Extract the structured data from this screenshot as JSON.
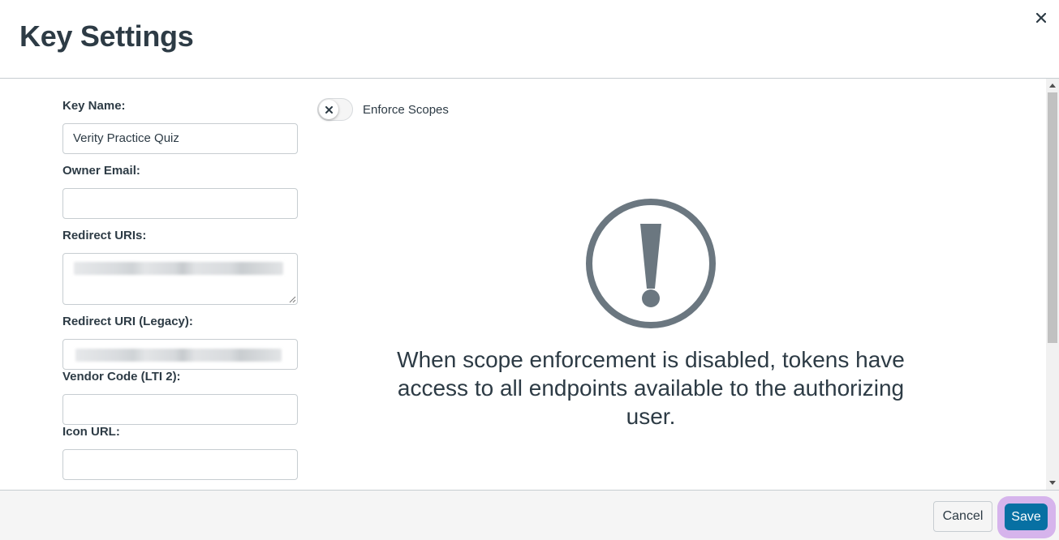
{
  "dialog": {
    "title": "Key Settings",
    "close_icon": "close-icon"
  },
  "form": {
    "key_name": {
      "label": "Key Name:",
      "value": "Verity Practice Quiz"
    },
    "owner_email": {
      "label": "Owner Email:",
      "value": ""
    },
    "redirect_uris": {
      "label": "Redirect URIs:",
      "value_redacted": true
    },
    "redirect_uri_legacy": {
      "label": "Redirect URI (Legacy):",
      "value_redacted": true
    },
    "vendor_code": {
      "label": "Vendor Code (LTI 2):",
      "value": ""
    },
    "icon_url": {
      "label": "Icon URL:",
      "value": ""
    }
  },
  "scopes": {
    "toggle_label": "Enforce Scopes",
    "enabled": false,
    "toggle_icon": "x-icon",
    "warning_icon": "exclamation-circle-icon",
    "message": "When scope enforcement is disabled, tokens have access to all endpoints available to the authorizing user."
  },
  "footer": {
    "cancel_label": "Cancel",
    "save_label": "Save"
  },
  "colors": {
    "text": "#2d3b45",
    "primary": "#0770a3",
    "icon_gray": "#6b7780",
    "focus_ring": "#d6b4ec",
    "border": "#c7cdd1"
  }
}
